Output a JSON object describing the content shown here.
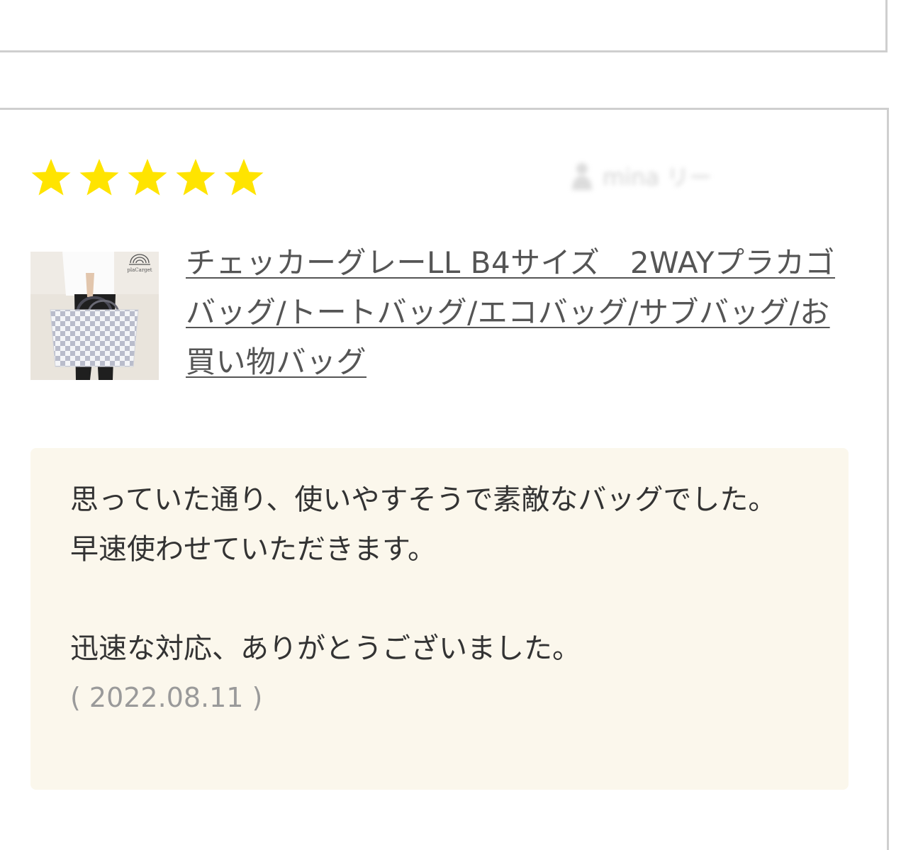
{
  "review": {
    "rating": 5,
    "star_color": "#FFE400",
    "reviewer_name": "mina リー",
    "product": {
      "thumbnail_brand": "plaCarget",
      "title": "チェッカーグレーLL B4サイズ　2WAYプラカゴバッグ/トートバッグ/エコバッグ/サブバッグ/お買い物バッグ"
    },
    "comment": "思っていた通り、使いやすそうで素敵なバッグでした。\n早速使わせていただきます。\n\n迅速な対応、ありがとうございました。",
    "date": "( 2022.08.11 )"
  },
  "colors": {
    "card_border": "#cfcfcf",
    "comment_bg": "#fbf7ec",
    "link_text": "#555555",
    "date_text": "#9a9a9a"
  },
  "icons": {
    "star": "star-icon",
    "reviewer": "person-icon"
  }
}
